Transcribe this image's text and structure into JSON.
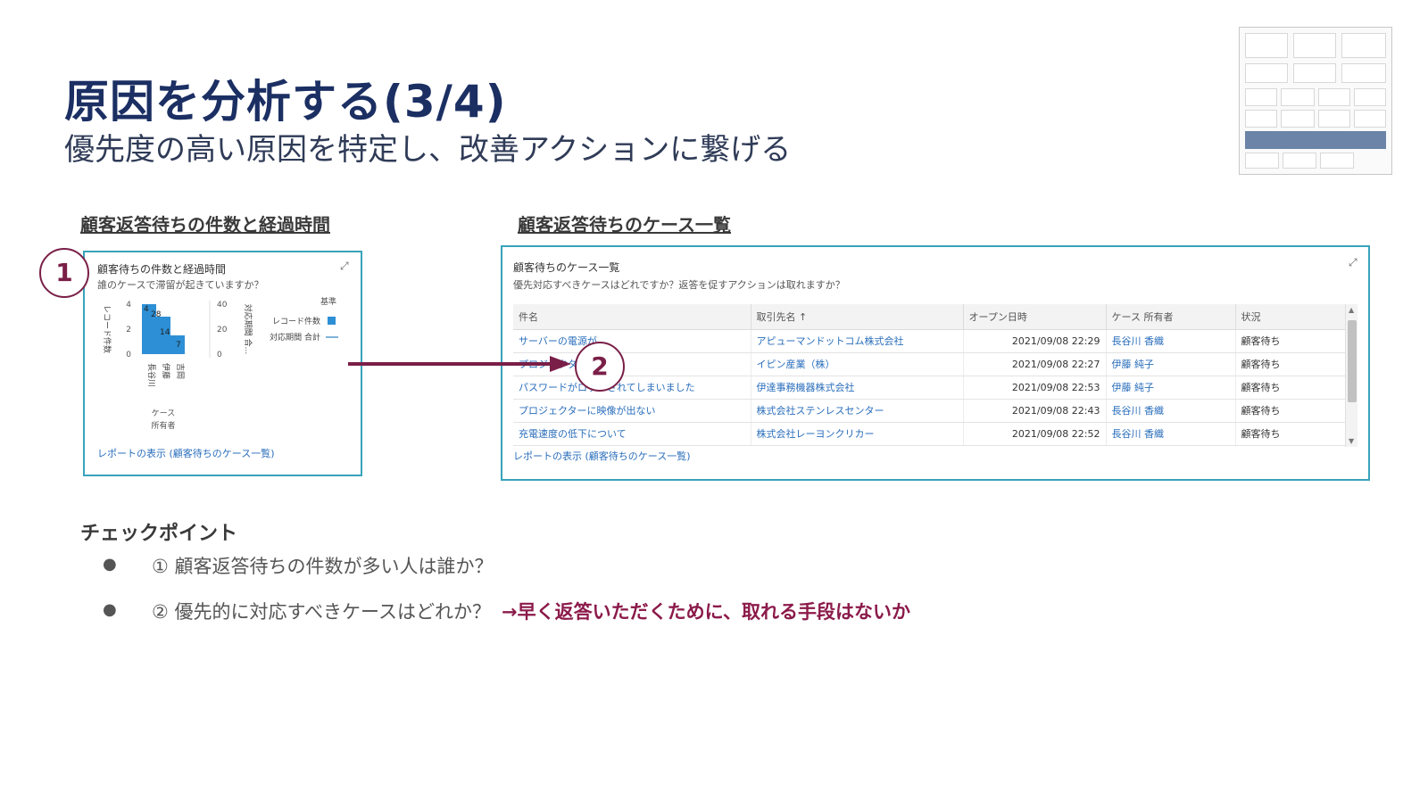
{
  "slide": {
    "title": "原因を分析する(3/4)",
    "subtitle": "優先度の高い原因を特定し、改善アクションに繋げる"
  },
  "left_section": {
    "heading": "顧客返答待ちの件数と経過時間",
    "card_title": "顧客待ちの件数と経過時間",
    "card_subtitle": "誰のケースで滞留が起きていますか？",
    "link": "レポートの表示 (顧客待ちのケース一覧)"
  },
  "right_section": {
    "heading": "顧客返答待ちのケース一覧",
    "card_title": "顧客待ちのケース一覧",
    "card_subtitle": "優先対応すべきケースはどれですか？返答を促すアクションは取れますか？",
    "link": "レポートの表示 (顧客待ちのケース一覧)",
    "table": {
      "headers": [
        "件名",
        "取引先名 ↑",
        "オープン日時",
        "ケース 所有者",
        "状況"
      ],
      "rows": [
        {
          "subject": "サーバーの電源が",
          "account": "アピューマンドットコム株式会社",
          "opened": "2021/09/08 22:29",
          "owner": "長谷川 香織",
          "status": "顧客待ち"
        },
        {
          "subject": "プロジェクターの",
          "account": "イピン産業（株）",
          "opened": "2021/09/08 22:27",
          "owner": "伊藤 純子",
          "status": "顧客待ち"
        },
        {
          "subject": "パスワードがロックされてしまいました",
          "account": "伊達事務機器株式会社",
          "opened": "2021/09/08 22:53",
          "owner": "伊藤 純子",
          "status": "顧客待ち"
        },
        {
          "subject": "プロジェクターに映像が出ない",
          "account": "株式会社ステンレスセンター",
          "opened": "2021/09/08 22:43",
          "owner": "長谷川 香織",
          "status": "顧客待ち"
        },
        {
          "subject": "充電速度の低下について",
          "account": "株式会社レーヨンクリカー",
          "opened": "2021/09/08 22:52",
          "owner": "長谷川 香織",
          "status": "顧客待ち"
        }
      ]
    }
  },
  "badges": {
    "one": "1",
    "two": "2"
  },
  "checkpoints": {
    "title": "チェックポイント",
    "items": [
      {
        "text": "① 顧客返答待ちの件数が多い人は誰か？",
        "emphasis": ""
      },
      {
        "text": "② 優先的に対応すべきケースはどれか？",
        "emphasis": "→早く返答いただくために、取れる手段はないか"
      }
    ]
  },
  "icons": {
    "expand": "expand-icon",
    "arrow": "right-arrow",
    "bullet": "bullet-dot"
  },
  "colors": {
    "title": "#1b2f63",
    "accent": "#7a1f47",
    "panel_border": "#38a3bb",
    "bar": "#2d8fd5",
    "link": "#2a6ebb"
  },
  "chart_data": {
    "type": "bar",
    "categories": [
      "長谷川",
      "伊藤",
      "吉岡"
    ],
    "series": [
      {
        "name": "レコード件数",
        "values": [
          4,
          3,
          1.5
        ]
      },
      {
        "name": "対応期間 合計",
        "values": [
          28,
          14,
          7
        ]
      }
    ],
    "data_labels": [
      "4",
      "28",
      "14",
      "7"
    ],
    "ylabel_left": "レコード件数",
    "ylabel_right": "対応期間 合...",
    "xlabel": "ケース 所有者",
    "legend_title": "基準",
    "left_ticks": [
      "4",
      "2",
      "0"
    ],
    "right_ticks": [
      "40",
      "20",
      "0"
    ],
    "ylim_left": [
      0,
      4
    ],
    "ylim_right": [
      0,
      40
    ]
  }
}
